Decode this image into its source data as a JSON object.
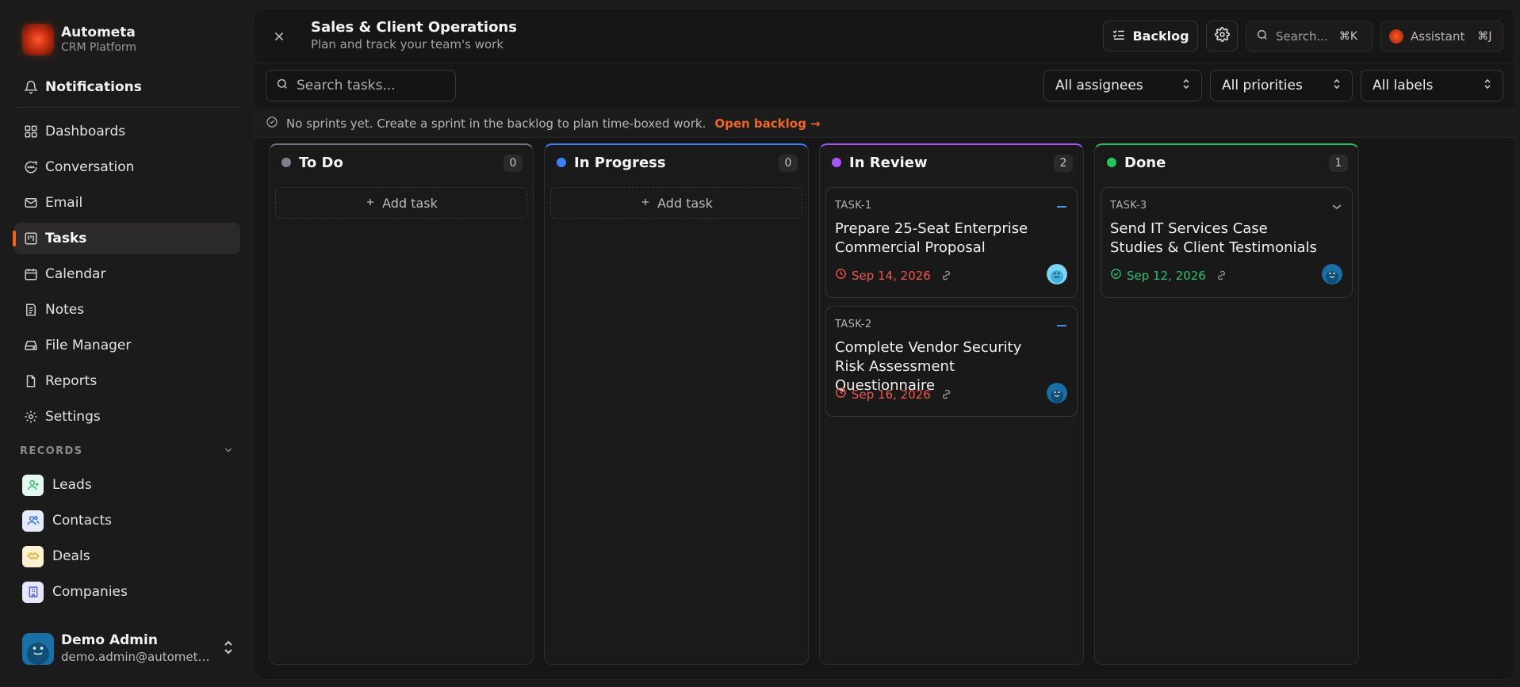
{
  "brand": {
    "name": "Autometa",
    "subtitle": "CRM Platform"
  },
  "nav": {
    "notifications": "Notifications",
    "items": [
      {
        "label": "Dashboards",
        "icon": "grid-icon"
      },
      {
        "label": "Conversation",
        "icon": "chat-icon"
      },
      {
        "label": "Email",
        "icon": "mail-icon"
      },
      {
        "label": "Tasks",
        "icon": "kanban-icon",
        "active": true
      },
      {
        "label": "Calendar",
        "icon": "calendar-icon"
      },
      {
        "label": "Notes",
        "icon": "notes-icon"
      },
      {
        "label": "File Manager",
        "icon": "drive-icon"
      },
      {
        "label": "Reports",
        "icon": "report-icon"
      },
      {
        "label": "Settings",
        "icon": "gear-icon"
      }
    ]
  },
  "records": {
    "heading": "RECORDS",
    "items": [
      {
        "label": "Leads",
        "color": "#2fbf71",
        "bg": "#e6f7ee"
      },
      {
        "label": "Contacts",
        "color": "#3b6fe0",
        "bg": "#e4ecfb"
      },
      {
        "label": "Deals",
        "color": "#e9a81d",
        "bg": "#fdf1d3"
      },
      {
        "label": "Companies",
        "color": "#5b5fd6",
        "bg": "#e6e7fa"
      }
    ]
  },
  "user": {
    "name": "Demo Admin",
    "email": "demo.admin@autometa..."
  },
  "header": {
    "title": "Sales & Client Operations",
    "subtitle": "Plan and track your team's work",
    "backlog_label": "Backlog",
    "search_label": "Search...",
    "search_kbd": "⌘K",
    "assistant_label": "Assistant",
    "assistant_kbd": "⌘J"
  },
  "filters": {
    "search_placeholder": "Search tasks...",
    "assignees": "All assignees",
    "priorities": "All priorities",
    "labels": "All labels"
  },
  "notice": {
    "text": "No sprints yet. Create a sprint in the backlog to plan time-boxed work.",
    "link": "Open backlog →"
  },
  "colors": {
    "accent": "#f26522",
    "overdue": "#f0564a",
    "done": "#2fbf71"
  },
  "columns": [
    {
      "name": "To Do",
      "count": "0",
      "color": "#7c8190",
      "add_label": "Add task",
      "cards": []
    },
    {
      "name": "In Progress",
      "count": "0",
      "color": "#3b82f6",
      "add_label": "Add task",
      "cards": []
    },
    {
      "name": "In Review",
      "count": "2",
      "color": "#a855f7",
      "add_label": "",
      "cards": [
        {
          "id": "TASK-1",
          "title": "Prepare 25-Seat Enterprise Commercial Proposal",
          "date": "Sep 14, 2026",
          "status": "overdue"
        },
        {
          "id": "TASK-2",
          "title": "Complete Vendor Security Risk Assessment Questionnaire",
          "date": "Sep 16, 2026",
          "status": "overdue"
        }
      ]
    },
    {
      "name": "Done",
      "count": "1",
      "color": "#22c55e",
      "add_label": "",
      "cards": [
        {
          "id": "TASK-3",
          "title": "Send IT Services Case Studies & Client Testimonials",
          "date": "Sep 12, 2026",
          "status": "done"
        }
      ]
    }
  ]
}
